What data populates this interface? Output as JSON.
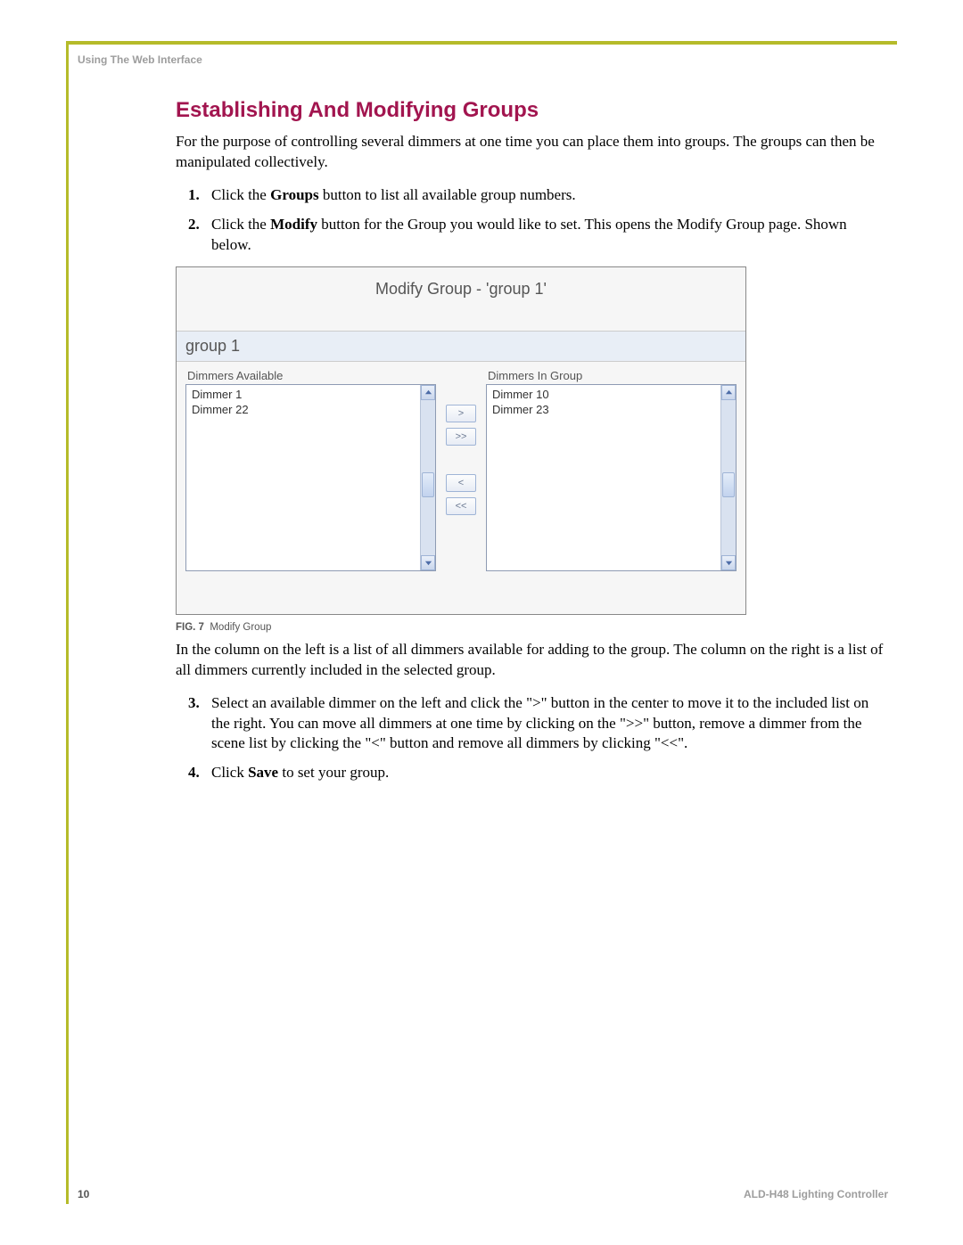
{
  "running_head": "Using The Web Interface",
  "section_title": "Establishing And Modifying Groups",
  "intro": "For the purpose of controlling several dimmers at one time you can place them into groups. The groups can then be manipulated collectively.",
  "step1_pre": "Click the ",
  "step1_bold": "Groups",
  "step1_post": " button to list all available group numbers.",
  "step2_pre": "Click the ",
  "step2_bold": "Modify",
  "step2_post": " button for the Group you would like to set. This opens the Modify Group page. Shown below.",
  "shot": {
    "title": "Modify Group - 'group 1'",
    "group_name": "group 1",
    "avail_label": "Dimmers Available",
    "ingroup_label": "Dimmers In Group",
    "available": [
      "Dimmer 1",
      "Dimmer 22"
    ],
    "in_group": [
      "Dimmer 10",
      "Dimmer 23"
    ],
    "btn_add": ">",
    "btn_add_all": ">>",
    "btn_remove": "<",
    "btn_remove_all": "<<"
  },
  "figure_tag": "FIG. 7",
  "figure_caption": "Modify Group",
  "para2": "In the column on the left is a list of all dimmers available for adding to the group. The column on the right is a list of all dimmers currently included in the selected group.",
  "step3": "Select an available dimmer on the left and click the \">\" button in the center to move it to the included list on the right. You can move all dimmers at one time by clicking on the \">>\" button, remove a dimmer from the scene list by clicking the \"<\" button and remove all dimmers by clicking \"<<\".",
  "step4_pre": "Click ",
  "step4_bold": "Save",
  "step4_post": " to set your group.",
  "page_number": "10",
  "doc_footer": "ALD-H48 Lighting Controller"
}
